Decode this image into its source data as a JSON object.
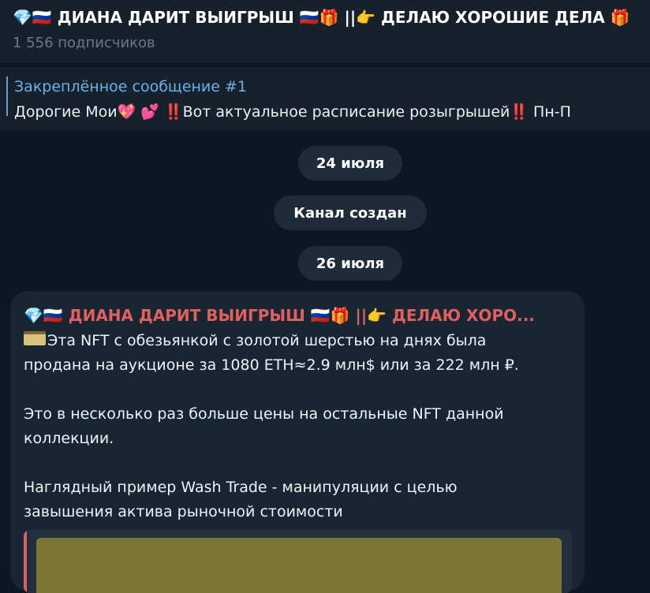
{
  "header": {
    "title": "💎🇷🇺 ДИАНА ДАРИТ ВЫИГРЫШ 🇷🇺🎁 ||👉 ДЕЛАЮ ХОРОШИЕ ДЕЛА 🎁",
    "subscribers": "1 556 подписчиков"
  },
  "pinned": {
    "title": "Закреплённое сообщение #1",
    "text": "Дорогие Мои💖 💕 ‼️Вот актуальное расписание розыгрышей‼️ Пн-П"
  },
  "dates": {
    "first": "24 июля",
    "service": "Канал создан",
    "second": "26 июля"
  },
  "message": {
    "author": "💎🇷🇺 ДИАНА ДАРИТ ВЫИГРЫШ 🇷🇺🎁 ||👉 ДЕЛАЮ ХОРО...",
    "line1": "Эта NFT с обезьянкой с золотой шерстью на днях была",
    "line2": "продана на аукционе за 1080 ETH≈2.9 млн$ или за 222 млн ₽.",
    "line3": "Это в несколько раз больше цены на остальные NFT данной",
    "line4": "коллекции.",
    "line5": "Наглядный пример Wash Trade - манипуляции с целью",
    "line6": "завышения актива рыночной стоимости",
    "icon": "credit-card-icon"
  },
  "colors": {
    "background": "#0e1621",
    "panel": "#17212b",
    "author": "#e0605f",
    "link": "#6cb1ea"
  }
}
